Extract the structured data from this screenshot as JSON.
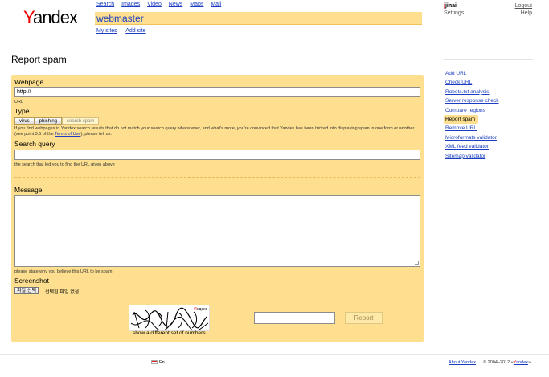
{
  "logo": {
    "first": "Y",
    "rest": "andex"
  },
  "topnav": [
    "Search",
    "Images",
    "Video",
    "News",
    "Maps",
    "Mail"
  ],
  "service": {
    "title": "webmaster"
  },
  "subnav": [
    "My sites",
    "Add site"
  ],
  "user": {
    "first": "j",
    "rest": "jinai",
    "settings": "Settings",
    "logout": "Logout",
    "help": "Help"
  },
  "page_title": "Report spam",
  "sidebar": [
    "Add URL",
    "Check URL",
    "Robots.txt analysis",
    "Server response check",
    "Compare regions",
    "Report spam",
    "Remove URL",
    "Microformats validator",
    "XML feed validator",
    "Sitemap validator"
  ],
  "form": {
    "webpage_label": "Webpage",
    "webpage_value": "http://",
    "webpage_hint": "URL",
    "type_label": "Type",
    "tabs": [
      "virus",
      "phishing",
      "search spam"
    ],
    "type_hint_1": "If you find webpages in Yandex search results that do not match your search query whatsoever, and what's more, you're convinced that Yandex has been tricked into displaying spam in one form or another",
    "type_hint_2a": "(see point 3.5 of the ",
    "type_hint_link": "Terms of Use",
    "type_hint_2b": "), please tell us.",
    "query_label": "Search query",
    "query_hint": "the search that led you to find the URL given above",
    "message_label": "Message",
    "message_hint": "please state why you believe this URL to be spam",
    "screenshot_label": "Screenshot",
    "file_button": "파일 선택",
    "file_status": "선택된 파일 없음",
    "captcha_brand_first": "Я",
    "captcha_brand_rest": "ндекс",
    "captcha_link": "show a different set of numbers",
    "submit": "Report"
  },
  "footer": {
    "lang": "En",
    "about": "About Yandex",
    "copy": "© 2004–2012 «",
    "copy_link_first": "Y",
    "copy_link_rest": "andex",
    "copy_end": "»"
  },
  "colors": {
    "accent": "#fddf8f",
    "link": "#1a3dc1",
    "brand_red": "#ee0000"
  }
}
